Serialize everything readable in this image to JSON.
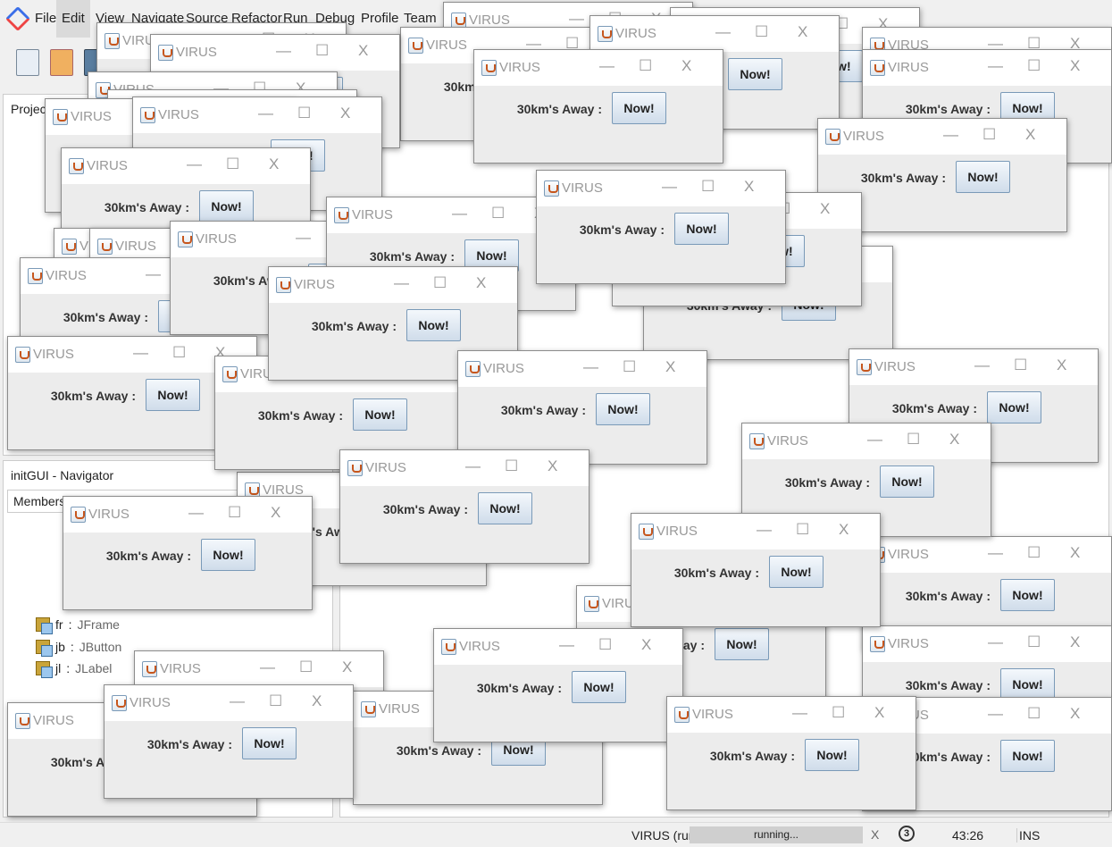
{
  "ide": {
    "menu": [
      "File",
      "Edit",
      "View",
      "Navigate",
      "Source",
      "Refactor",
      "Run",
      "Debug",
      "Profile",
      "Team"
    ],
    "projects_tab": "Projects",
    "navigator_title": "initGUI - Navigator",
    "members_label": "Members",
    "members": [
      {
        "name": "fr",
        "type": "JFrame"
      },
      {
        "name": "jb",
        "type": "JButton"
      },
      {
        "name": "jl",
        "type": "JLabel"
      }
    ]
  },
  "virus_window": {
    "title": "VIRUS",
    "label": "30km's Away :",
    "button": "Now!",
    "minimize": "—",
    "maximize": "☐",
    "close": "X"
  },
  "status": {
    "task": "VIRUS (run)",
    "progress_text": "running...",
    "cancel": "X",
    "notifications": "3",
    "caret_position": "43:26",
    "insert_mode": "INS"
  }
}
